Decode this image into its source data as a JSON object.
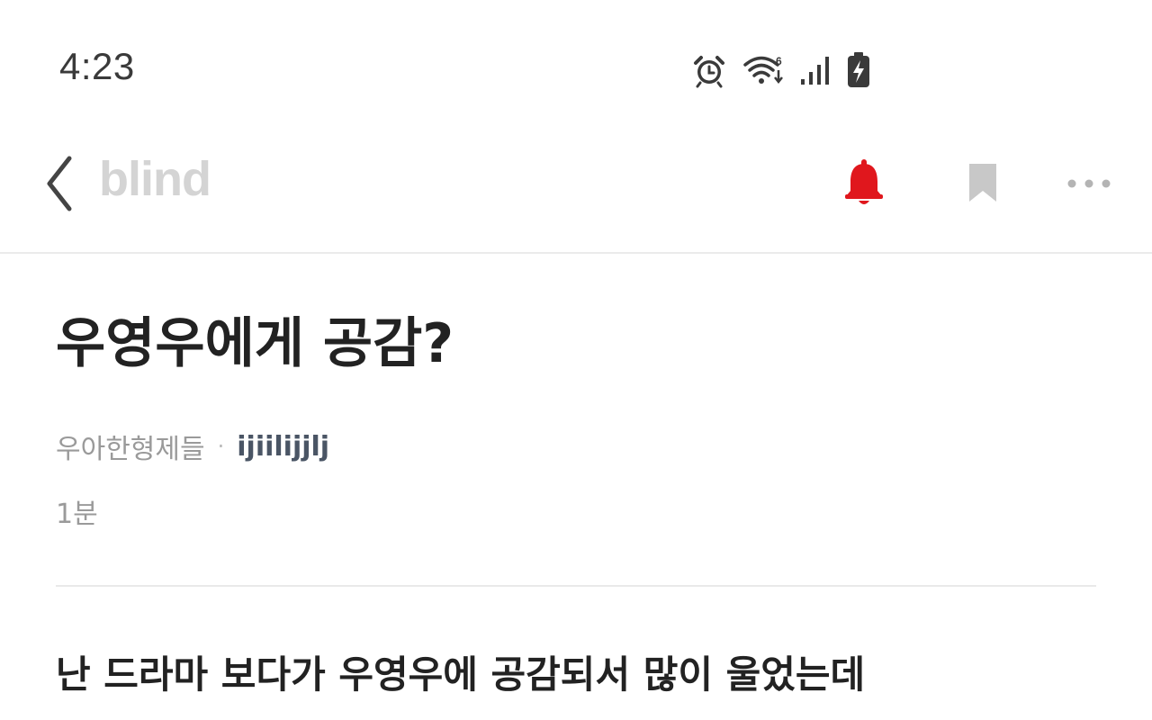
{
  "status_bar": {
    "time": "4:23",
    "icons": [
      "alarm-icon",
      "wifi-icon",
      "signal-icon",
      "battery-charging-icon"
    ]
  },
  "header": {
    "logo": "blind",
    "icons": [
      "back-chevron-icon",
      "bell-icon",
      "bookmark-icon",
      "more-icon"
    ],
    "colors": {
      "bell": "#e0171d",
      "bookmark": "#c8c8c8",
      "logo": "#d4d4d4"
    }
  },
  "post": {
    "title": "우영우에게 공감?",
    "company": "우아한형제들",
    "separator": "·",
    "author": "ijiilijjlj",
    "time_ago": "1분",
    "body": "난 드라마 보다가 우영우에 공감되서 많이 울었는데"
  }
}
